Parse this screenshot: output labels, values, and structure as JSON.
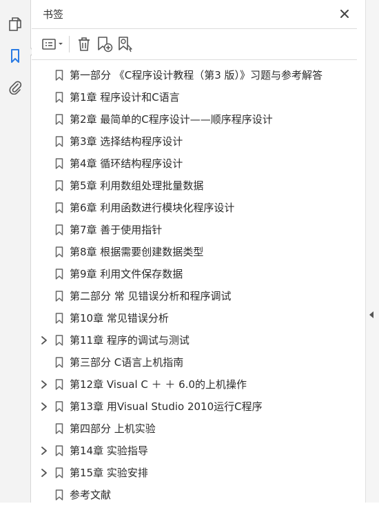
{
  "panel": {
    "title": "书签"
  },
  "rail": {
    "icons": [
      "pages-icon",
      "bookmark-icon",
      "attachment-icon"
    ]
  },
  "toolbar": {
    "icons": [
      "options-icon",
      "delete-icon",
      "new-bookmark-icon",
      "find-bookmark-icon"
    ]
  },
  "bookmarks": [
    {
      "label": "第一部分 《C程序设计教程（第3 版）》习题与参考解答",
      "expandable": false
    },
    {
      "label": "第1章 程序设计和C语言",
      "expandable": false
    },
    {
      "label": "第2章 最简单的C程序设计——顺序程序设计",
      "expandable": false
    },
    {
      "label": "第3章 选择结构程序设计",
      "expandable": false
    },
    {
      "label": "第4章 循环结构程序设计",
      "expandable": false
    },
    {
      "label": "第5章 利用数组处理批量数据",
      "expandable": false
    },
    {
      "label": "第6章 利用函数进行模块化程序设计",
      "expandable": false
    },
    {
      "label": "第7章 善于使用指针",
      "expandable": false
    },
    {
      "label": "第8章 根据需要创建数据类型",
      "expandable": false
    },
    {
      "label": "第9章 利用文件保存数据",
      "expandable": false
    },
    {
      "label": "第二部分 常 见错误分析和程序调试",
      "expandable": false
    },
    {
      "label": "第10章 常见错误分析",
      "expandable": false
    },
    {
      "label": "第11章 程序的调试与测试",
      "expandable": true
    },
    {
      "label": "第三部分 C语言上机指南",
      "expandable": false
    },
    {
      "label": "第12章 Visual C ＋ ＋ 6.0的上机操作",
      "expandable": true
    },
    {
      "label": "第13章 用Visual Studio 2010运行C程序",
      "expandable": true
    },
    {
      "label": "第四部分 上机实验",
      "expandable": false
    },
    {
      "label": "第14章 实验指导",
      "expandable": true
    },
    {
      "label": "第15章 实验安排",
      "expandable": true
    },
    {
      "label": "参考文献",
      "expandable": false
    }
  ]
}
